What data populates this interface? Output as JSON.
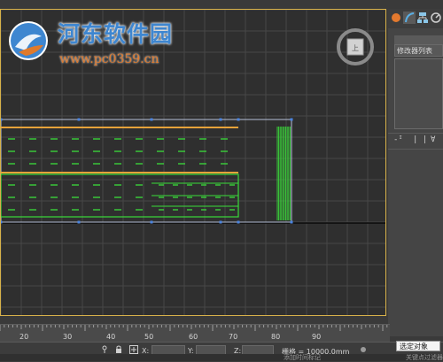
{
  "logo": {
    "name": "河东软件园",
    "url": "www.pc0359.cn",
    "colors": {
      "brand": "#3e86d0",
      "url": "#e07a2c"
    }
  },
  "viewcube": {
    "icon": "viewcube-icon"
  },
  "command_panel": {
    "tabs": [
      {
        "icon": "create-sphere-icon"
      },
      {
        "icon": "modify-arc-icon"
      },
      {
        "icon": "hierarchy-icon"
      },
      {
        "icon": "motion-icon"
      }
    ],
    "modifier_list_label": "修改器列表",
    "stack_tools": [
      "-ᴵ",
      "| |",
      "∀"
    ]
  },
  "timeline": {
    "ticks": [
      "20",
      "30",
      "40",
      "50",
      "60",
      "70",
      "80",
      "90"
    ]
  },
  "statusbar": {
    "x_label": "X:",
    "y_label": "Y:",
    "z_label": "Z:",
    "grid_text": "栅格 = 10000.0mm",
    "selection_popup": "选定对象"
  },
  "bottom_strip": {
    "left_text": "添加时间标记",
    "right_text": "关键点过滤器"
  },
  "colors": {
    "viewport_bg": "#2f2f2f",
    "grid_line": "#474747",
    "object_green": "#3adc3a",
    "object_orange": "#e6a23a",
    "selection_border": "#d8b24a"
  }
}
